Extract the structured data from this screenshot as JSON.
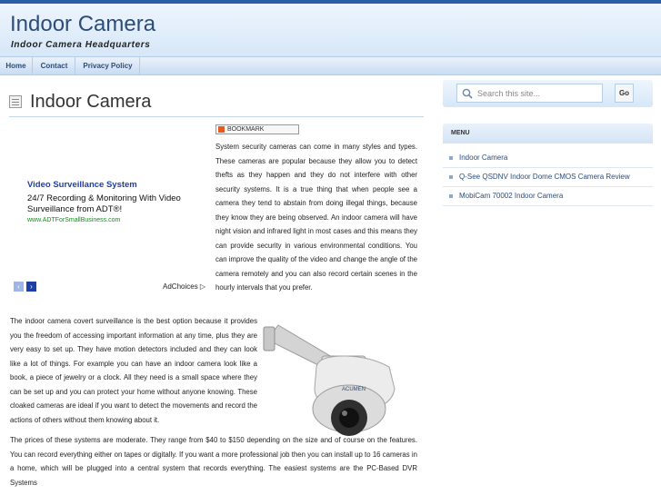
{
  "site": {
    "title": "Indoor Camera",
    "description": "Indoor Camera Headquarters"
  },
  "nav": {
    "items": [
      {
        "label": "Home"
      },
      {
        "label": "Contact"
      },
      {
        "label": "Privacy Policy"
      }
    ]
  },
  "post": {
    "title": "Indoor Camera",
    "bookmark_label": "BOOKMARK",
    "paragraphs": [
      "System security cameras can come in many styles and types. These cameras are popular because they allow you to detect thefts as they happen and they do not interfere with other security systems. It is a true thing that when people see a camera they tend to abstain from doing illegal things, because they know they are being observed. An indoor camera will have night vision and infrared light in most cases and this means they can provide security in various environmental conditions. You can improve the quality of the video and change the angle of the camera remotely and you can also record certain scenes in the hourly intervals that you prefer.",
      "The indoor camera covert surveillance is the best option because it provides you the freedom of accessing important information at any time, plus they are very easy to set up. They have motion detectors included and they can look like a lot of things. For example you can have an indoor camera look like a book, a piece of jewelry or a clock. All they need is a small space where they can be set up and you can protect your home without anyone knowing. These cloaked cameras are ideal if you want to detect the movements and record the actions of others without them knowing about it.",
      "The prices of these systems are moderate. They range from $40 to $150 depending on the size and of course on the features. You can record everything either on tapes or digitally. If you want a more professional job then you can install up to 16 cameras in a home, which will be plugged into a central system that records everything. The easiest systems are the PC-Based DVR Systems"
    ],
    "camera_brand": "ACUMEN"
  },
  "ad": {
    "link": "Video Surveillance System",
    "text": "24/7 Recording & Monitoring With Video Surveillance from ADT®!",
    "url": "www.ADTForSmallBusiness.com",
    "choices": "AdChoices",
    "prev_icon": "‹",
    "next_icon": "›"
  },
  "sidebar": {
    "search_placeholder": "Search this site...",
    "search_button": "Go",
    "menu_title": "MENU",
    "menu_items": [
      {
        "label": "Indoor Camera"
      },
      {
        "label": "Q-See QSDNV Indoor Dome CMOS Camera Review"
      },
      {
        "label": "MobiCam 70002 Indoor Camera"
      }
    ]
  },
  "colors": {
    "accent": "#2b4d78",
    "ad_link": "#1d3fa8",
    "ad_url": "#1a8a24"
  }
}
